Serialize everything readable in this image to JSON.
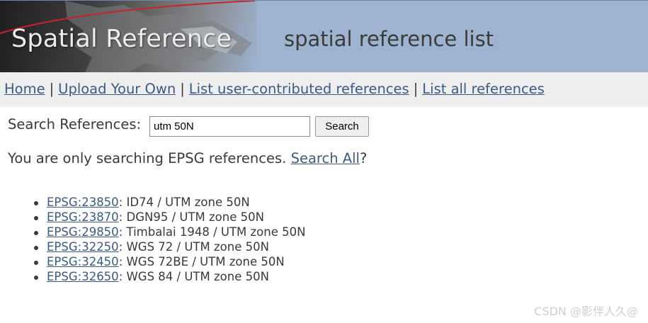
{
  "header": {
    "logo_text": "Spatial Reference",
    "title": "spatial reference list"
  },
  "nav": {
    "items": [
      {
        "label": "Home"
      },
      {
        "label": "Upload Your Own"
      },
      {
        "label": "List user-contributed references"
      },
      {
        "label": "List all references"
      }
    ],
    "separator": "|"
  },
  "search": {
    "label": "Search References:",
    "value": "utm 50N",
    "button_label": "Search"
  },
  "notice": {
    "text": "You are only searching EPSG references.",
    "link": "Search All",
    "suffix": "?"
  },
  "results": [
    {
      "code": "EPSG:23850",
      "name": ": ID74 / UTM zone 50N"
    },
    {
      "code": "EPSG:23870",
      "name": ": DGN95 / UTM zone 50N"
    },
    {
      "code": "EPSG:29850",
      "name": ": Timbalai 1948 / UTM zone 50N"
    },
    {
      "code": "EPSG:32250",
      "name": ": WGS 72 / UTM zone 50N"
    },
    {
      "code": "EPSG:32450",
      "name": ": WGS 72BE / UTM zone 50N"
    },
    {
      "code": "EPSG:32650",
      "name": ": WGS 84 / UTM zone 50N"
    }
  ],
  "watermark": "CSDN @影伴人久@",
  "colors": {
    "banner": "#9db3cf",
    "navbar": "#eeeeee",
    "link": "#3d5a80",
    "text": "#3a3a3a"
  }
}
